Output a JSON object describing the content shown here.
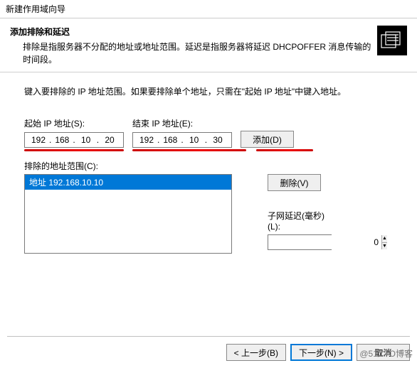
{
  "window": {
    "title": "新建作用域向导"
  },
  "header": {
    "title": "添加排除和延迟",
    "desc": "排除是指服务器不分配的地址或地址范围。延迟是指服务器将延迟 DHCPOFFER 消息传输的时间段。"
  },
  "instruction": "键入要排除的 IP 地址范围。如果要排除单个地址，只需在\"起始 IP 地址\"中键入地址。",
  "startIp": {
    "label": "起始 IP 地址(S):",
    "o1": "192",
    "o2": "168",
    "o3": "10",
    "o4": "20"
  },
  "endIp": {
    "label": "结束 IP 地址(E):",
    "o1": "192",
    "o2": "168",
    "o3": "10",
    "o4": "30"
  },
  "buttons": {
    "add": "添加(D)",
    "delete": "删除(V)",
    "back": "< 上一步(B)",
    "next": "下一步(N) >",
    "cancel": "取消"
  },
  "excluded": {
    "label": "排除的地址范围(C):",
    "items": [
      "地址 192.168.10.10"
    ]
  },
  "delay": {
    "label": "子网延迟(毫秒)(L):",
    "value": "0"
  },
  "watermark": "@51CTO博客"
}
